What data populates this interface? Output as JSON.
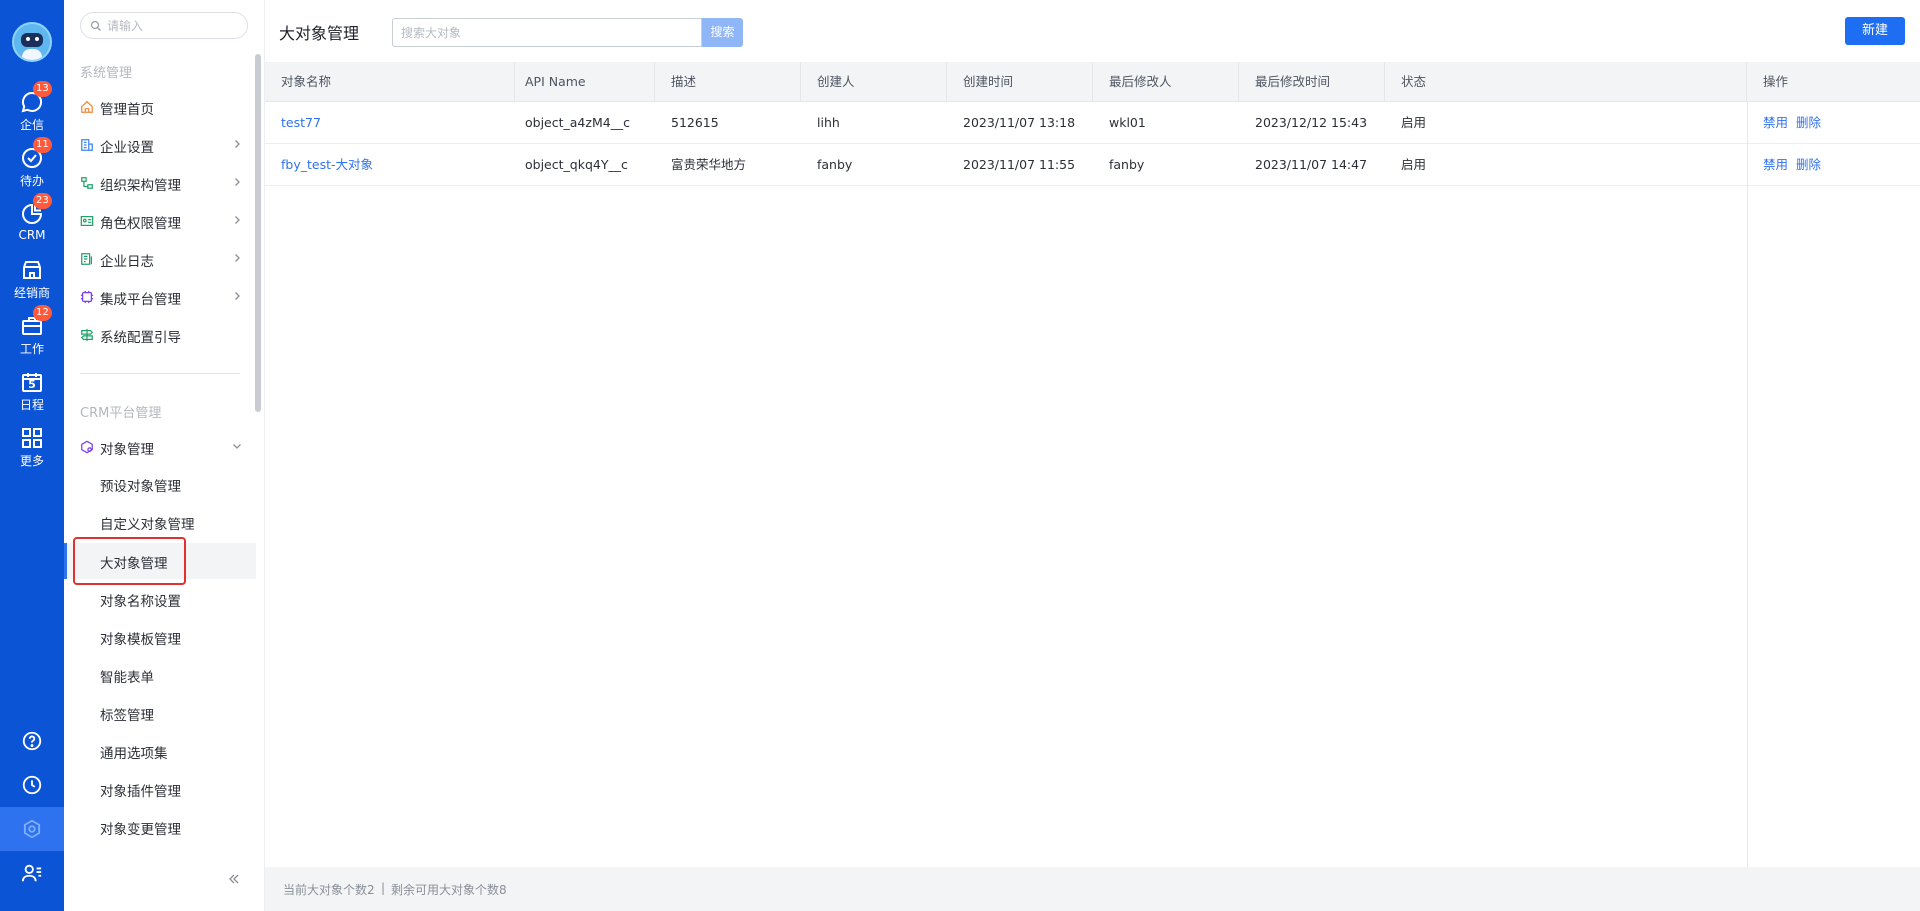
{
  "rail": {
    "items": [
      {
        "label": "企信",
        "badge": "13",
        "icon": "chat-icon"
      },
      {
        "label": "待办",
        "badge": "11",
        "icon": "check-circle-icon"
      },
      {
        "label": "CRM",
        "badge": "23",
        "icon": "pie-chart-icon"
      },
      {
        "label": "经销商",
        "badge": "",
        "icon": "store-icon"
      },
      {
        "label": "工作",
        "badge": "12",
        "icon": "briefcase-icon"
      },
      {
        "label": "日程",
        "badge": "",
        "icon": "calendar-icon",
        "day": "5"
      },
      {
        "label": "更多",
        "badge": "",
        "icon": "grid-icon"
      }
    ],
    "bottom": [
      "help-icon",
      "clock-icon",
      "settings-icon",
      "user-list-icon"
    ],
    "accent": "#0c54d6"
  },
  "sidebar": {
    "search_placeholder": "请输入",
    "section1": "系统管理",
    "items": [
      {
        "label": "管理首页"
      },
      {
        "label": "企业设置"
      },
      {
        "label": "组织架构管理"
      },
      {
        "label": "角色权限管理"
      },
      {
        "label": "企业日志"
      },
      {
        "label": "集成平台管理"
      },
      {
        "label": "系统配置引导"
      }
    ],
    "section2": "CRM平台管理",
    "object_mgmt": "对象管理",
    "sub_items": [
      {
        "label": "预设对象管理"
      },
      {
        "label": "自定义对象管理"
      },
      {
        "label": "大对象管理"
      },
      {
        "label": "对象名称设置"
      },
      {
        "label": "对象模板管理"
      },
      {
        "label": "智能表单"
      },
      {
        "label": "标签管理"
      },
      {
        "label": "通用选项集"
      },
      {
        "label": "对象插件管理"
      },
      {
        "label": "对象变更管理"
      }
    ]
  },
  "main": {
    "title": "大对象管理",
    "search_placeholder": "搜索大对象",
    "search_button": "搜索",
    "new_button": "新建",
    "columns": [
      "对象名称",
      "API Name",
      "描述",
      "创建人",
      "创建时间",
      "最后修改人",
      "最后修改时间",
      "状态",
      "操作"
    ],
    "rows": [
      {
        "name": "test77",
        "api": "object_a4zM4__c",
        "desc": "512615",
        "creator": "lihh",
        "created": "2023/11/07 13:18",
        "modifier": "wkl01",
        "modified": "2023/12/12 15:43",
        "status": "启用",
        "op1": "禁用",
        "op2": "删除"
      },
      {
        "name": "fby_test-大对象",
        "api": "object_qkq4Y__c",
        "desc": "富贵荣华地方",
        "creator": "fanby",
        "created": "2023/11/07 11:55",
        "modifier": "fanby",
        "modified": "2023/11/07 14:47",
        "status": "启用",
        "op1": "禁用",
        "op2": "删除"
      }
    ],
    "footer_count": "当前大对象个数2",
    "footer_sep": "|",
    "footer_remaining": "剩余可用大对象个数8"
  }
}
